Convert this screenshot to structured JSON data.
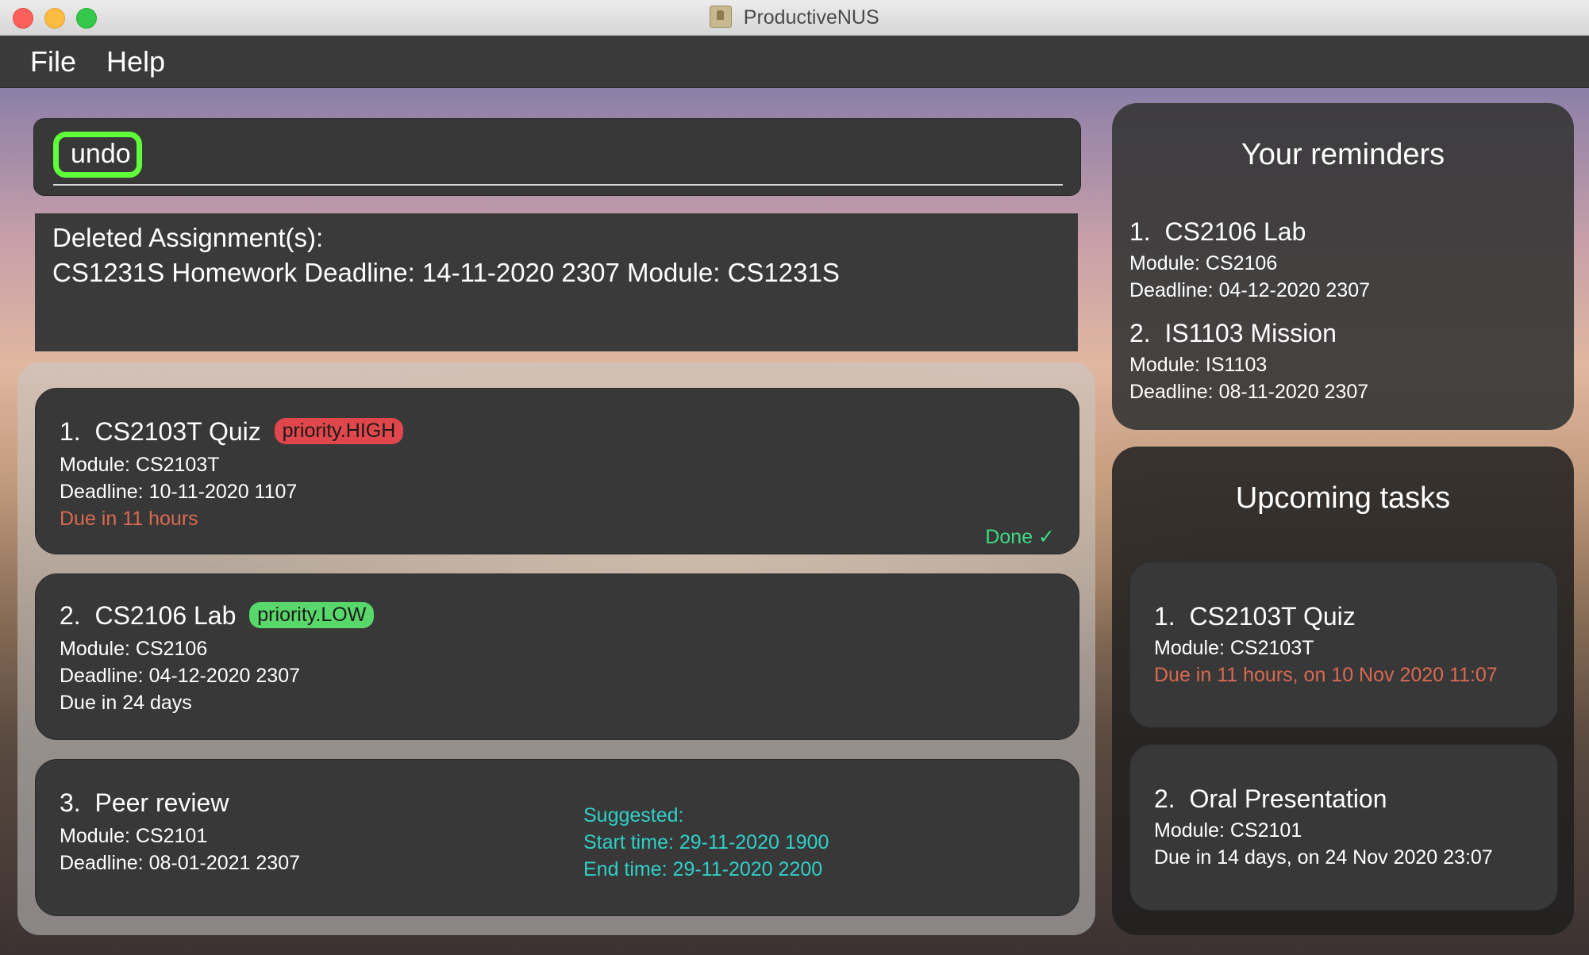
{
  "window": {
    "title": "ProductiveNUS"
  },
  "menu": {
    "file": "File",
    "help": "Help"
  },
  "command": {
    "value": "undo"
  },
  "result": {
    "line1": "Deleted Assignment(s):",
    "line2": "CS1231S Homework Deadline: 14-11-2020 2307 Module: CS1231S"
  },
  "assignments": [
    {
      "index": "1.",
      "name": "CS2103T Quiz",
      "priority": "priority.HIGH",
      "module": "Module: CS2103T",
      "deadline": "Deadline: 10-11-2020 1107",
      "due": "Due in 11 hours",
      "done": "Done ✓"
    },
    {
      "index": "2.",
      "name": "CS2106 Lab",
      "priority": "priority.LOW",
      "module": "Module: CS2106",
      "deadline": "Deadline: 04-12-2020 2307",
      "due": "Due in 24 days"
    },
    {
      "index": "3.",
      "name": "Peer review",
      "module": "Module: CS2101",
      "deadline": "Deadline: 08-01-2021 2307",
      "suggested": "Suggested:",
      "start": "Start time: 29-11-2020 1900",
      "end": "End time: 29-11-2020 2200"
    }
  ],
  "reminders": {
    "heading": "Your reminders",
    "items": [
      {
        "index": "1.",
        "name": "CS2106 Lab",
        "module": "Module: CS2106",
        "deadline": "Deadline: 04-12-2020 2307"
      },
      {
        "index": "2.",
        "name": "IS1103 Mission",
        "module": "Module: IS1103",
        "deadline": "Deadline: 08-11-2020 2307"
      }
    ]
  },
  "upcoming": {
    "heading": "Upcoming tasks",
    "items": [
      {
        "index": "1.",
        "name": "CS2103T Quiz",
        "module": "Module: CS2103T",
        "due": "Due in 11 hours, on 10 Nov 2020 11:07"
      },
      {
        "index": "2.",
        "name": "Oral Presentation",
        "module": "Module: CS2101",
        "due": "Due in 14 days, on 24 Nov 2020 23:07"
      }
    ]
  },
  "colors": {
    "highlight_green": "#5fff3a",
    "priority_high": "#e0474c",
    "priority_low": "#58d86a",
    "due_red": "#d96a52",
    "done_green": "#3ddc84",
    "suggested_cyan": "#2fd0c7"
  }
}
